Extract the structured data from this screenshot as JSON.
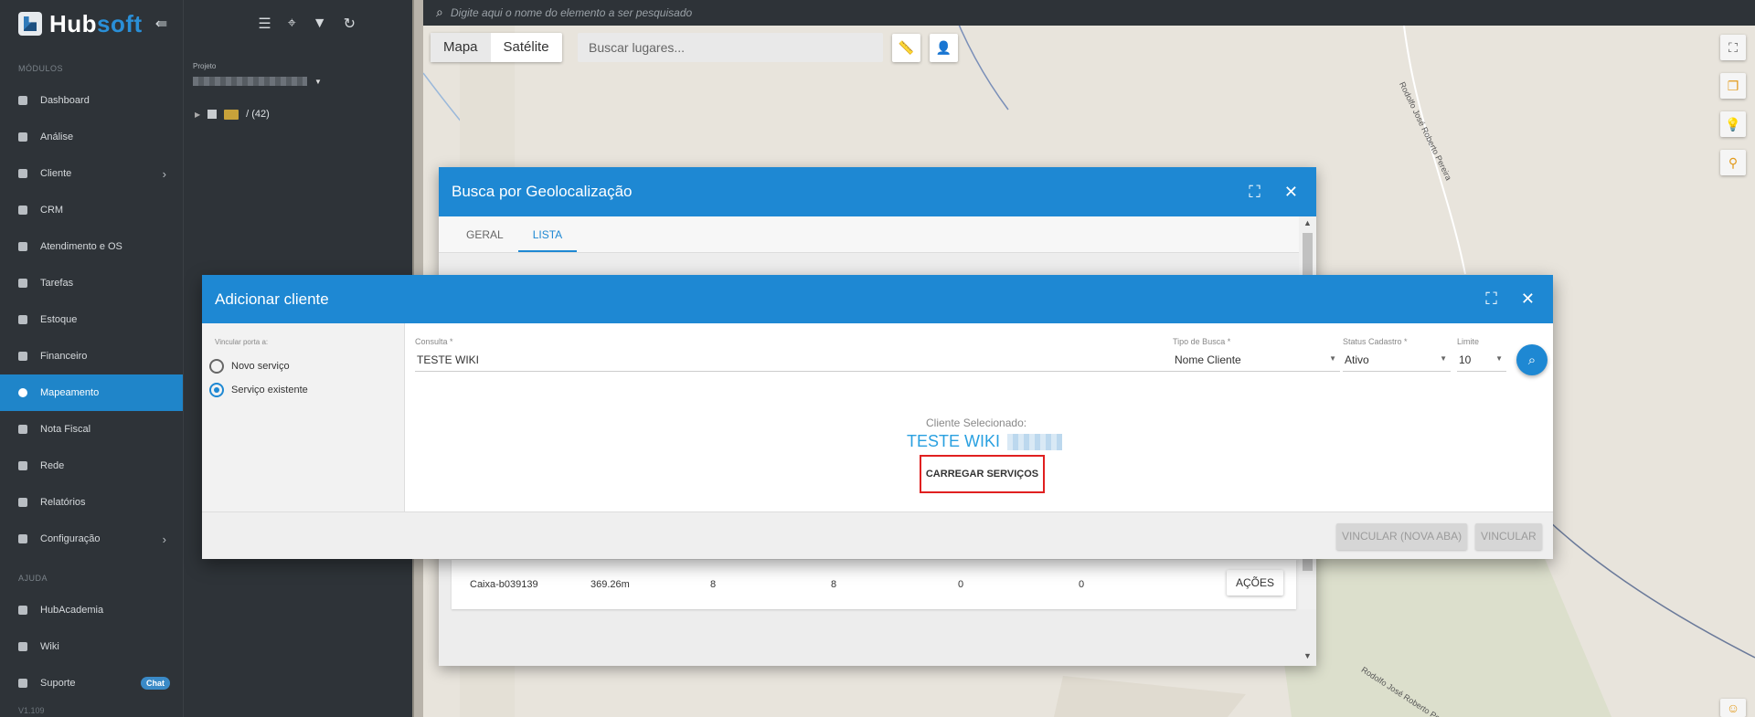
{
  "sidebar": {
    "brand_part1": "Hub",
    "brand_part2": "soft",
    "section_modules": "MÓDULOS",
    "items": [
      {
        "label": "Dashboard"
      },
      {
        "label": "Análise"
      },
      {
        "label": "Cliente"
      },
      {
        "label": "CRM"
      },
      {
        "label": "Atendimento e OS"
      },
      {
        "label": "Tarefas"
      },
      {
        "label": "Estoque"
      },
      {
        "label": "Financeiro"
      },
      {
        "label": "Mapeamento"
      },
      {
        "label": "Nota Fiscal"
      },
      {
        "label": "Rede"
      },
      {
        "label": "Relatórios"
      },
      {
        "label": "Configuração"
      }
    ],
    "section_help": "AJUDA",
    "help_items": [
      {
        "label": "HubAcademia"
      },
      {
        "label": "Wiki"
      },
      {
        "label": "Suporte"
      }
    ],
    "chat_badge": "Chat",
    "version": "V1.109"
  },
  "project": {
    "label": "Projeto",
    "tree_label": "/ (42)"
  },
  "map": {
    "search_placeholder": "Digite aqui o nome do elemento a ser pesquisado",
    "tab_map": "Mapa",
    "tab_satellite": "Satélite",
    "places_placeholder": "Buscar lugares...",
    "road_name": "Rodolfo José Roberto Pereira"
  },
  "geo_dialog": {
    "title": "Busca por Geolocalização",
    "tabs": [
      {
        "label": "GERAL"
      },
      {
        "label": "LISTA"
      }
    ],
    "row": {
      "name": "Caixa-b039139",
      "distance": "369.26m",
      "c1": "8",
      "c2": "8",
      "c3": "0",
      "c4": "0",
      "action": "AÇÕES"
    }
  },
  "add_dialog": {
    "title": "Adicionar cliente",
    "link_label": "Vincular porta a:",
    "option_new": "Novo serviço",
    "option_existing": "Serviço existente",
    "consulta_label": "Consulta *",
    "consulta_value": "TESTE WIKI",
    "tipo_label": "Tipo de Busca *",
    "tipo_value": "Nome Cliente",
    "status_label": "Status Cadastro *",
    "status_value": "Ativo",
    "limite_label": "Limite",
    "limite_value": "10",
    "selected_label": "Cliente Selecionado:",
    "selected_name": "TESTE WIKI",
    "load_button": "CARREGAR SERVIÇOS",
    "btn_new_tab": "VINCULAR (NOVA ABA)",
    "btn_link": "VINCULAR"
  }
}
